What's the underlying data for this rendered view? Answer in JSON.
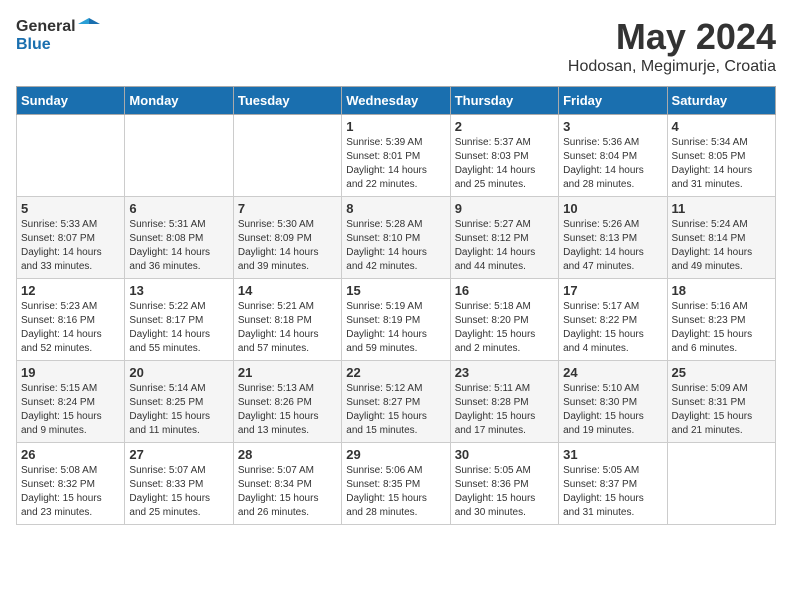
{
  "header": {
    "logo_general": "General",
    "logo_blue": "Blue",
    "month_title": "May 2024",
    "location": "Hodosan, Megimurje, Croatia"
  },
  "weekdays": [
    "Sunday",
    "Monday",
    "Tuesday",
    "Wednesday",
    "Thursday",
    "Friday",
    "Saturday"
  ],
  "weeks": [
    [
      {
        "day": "",
        "content": ""
      },
      {
        "day": "",
        "content": ""
      },
      {
        "day": "",
        "content": ""
      },
      {
        "day": "1",
        "content": "Sunrise: 5:39 AM\nSunset: 8:01 PM\nDaylight: 14 hours\nand 22 minutes."
      },
      {
        "day": "2",
        "content": "Sunrise: 5:37 AM\nSunset: 8:03 PM\nDaylight: 14 hours\nand 25 minutes."
      },
      {
        "day": "3",
        "content": "Sunrise: 5:36 AM\nSunset: 8:04 PM\nDaylight: 14 hours\nand 28 minutes."
      },
      {
        "day": "4",
        "content": "Sunrise: 5:34 AM\nSunset: 8:05 PM\nDaylight: 14 hours\nand 31 minutes."
      }
    ],
    [
      {
        "day": "5",
        "content": "Sunrise: 5:33 AM\nSunset: 8:07 PM\nDaylight: 14 hours\nand 33 minutes."
      },
      {
        "day": "6",
        "content": "Sunrise: 5:31 AM\nSunset: 8:08 PM\nDaylight: 14 hours\nand 36 minutes."
      },
      {
        "day": "7",
        "content": "Sunrise: 5:30 AM\nSunset: 8:09 PM\nDaylight: 14 hours\nand 39 minutes."
      },
      {
        "day": "8",
        "content": "Sunrise: 5:28 AM\nSunset: 8:10 PM\nDaylight: 14 hours\nand 42 minutes."
      },
      {
        "day": "9",
        "content": "Sunrise: 5:27 AM\nSunset: 8:12 PM\nDaylight: 14 hours\nand 44 minutes."
      },
      {
        "day": "10",
        "content": "Sunrise: 5:26 AM\nSunset: 8:13 PM\nDaylight: 14 hours\nand 47 minutes."
      },
      {
        "day": "11",
        "content": "Sunrise: 5:24 AM\nSunset: 8:14 PM\nDaylight: 14 hours\nand 49 minutes."
      }
    ],
    [
      {
        "day": "12",
        "content": "Sunrise: 5:23 AM\nSunset: 8:16 PM\nDaylight: 14 hours\nand 52 minutes."
      },
      {
        "day": "13",
        "content": "Sunrise: 5:22 AM\nSunset: 8:17 PM\nDaylight: 14 hours\nand 55 minutes."
      },
      {
        "day": "14",
        "content": "Sunrise: 5:21 AM\nSunset: 8:18 PM\nDaylight: 14 hours\nand 57 minutes."
      },
      {
        "day": "15",
        "content": "Sunrise: 5:19 AM\nSunset: 8:19 PM\nDaylight: 14 hours\nand 59 minutes."
      },
      {
        "day": "16",
        "content": "Sunrise: 5:18 AM\nSunset: 8:20 PM\nDaylight: 15 hours\nand 2 minutes."
      },
      {
        "day": "17",
        "content": "Sunrise: 5:17 AM\nSunset: 8:22 PM\nDaylight: 15 hours\nand 4 minutes."
      },
      {
        "day": "18",
        "content": "Sunrise: 5:16 AM\nSunset: 8:23 PM\nDaylight: 15 hours\nand 6 minutes."
      }
    ],
    [
      {
        "day": "19",
        "content": "Sunrise: 5:15 AM\nSunset: 8:24 PM\nDaylight: 15 hours\nand 9 minutes."
      },
      {
        "day": "20",
        "content": "Sunrise: 5:14 AM\nSunset: 8:25 PM\nDaylight: 15 hours\nand 11 minutes."
      },
      {
        "day": "21",
        "content": "Sunrise: 5:13 AM\nSunset: 8:26 PM\nDaylight: 15 hours\nand 13 minutes."
      },
      {
        "day": "22",
        "content": "Sunrise: 5:12 AM\nSunset: 8:27 PM\nDaylight: 15 hours\nand 15 minutes."
      },
      {
        "day": "23",
        "content": "Sunrise: 5:11 AM\nSunset: 8:28 PM\nDaylight: 15 hours\nand 17 minutes."
      },
      {
        "day": "24",
        "content": "Sunrise: 5:10 AM\nSunset: 8:30 PM\nDaylight: 15 hours\nand 19 minutes."
      },
      {
        "day": "25",
        "content": "Sunrise: 5:09 AM\nSunset: 8:31 PM\nDaylight: 15 hours\nand 21 minutes."
      }
    ],
    [
      {
        "day": "26",
        "content": "Sunrise: 5:08 AM\nSunset: 8:32 PM\nDaylight: 15 hours\nand 23 minutes."
      },
      {
        "day": "27",
        "content": "Sunrise: 5:07 AM\nSunset: 8:33 PM\nDaylight: 15 hours\nand 25 minutes."
      },
      {
        "day": "28",
        "content": "Sunrise: 5:07 AM\nSunset: 8:34 PM\nDaylight: 15 hours\nand 26 minutes."
      },
      {
        "day": "29",
        "content": "Sunrise: 5:06 AM\nSunset: 8:35 PM\nDaylight: 15 hours\nand 28 minutes."
      },
      {
        "day": "30",
        "content": "Sunrise: 5:05 AM\nSunset: 8:36 PM\nDaylight: 15 hours\nand 30 minutes."
      },
      {
        "day": "31",
        "content": "Sunrise: 5:05 AM\nSunset: 8:37 PM\nDaylight: 15 hours\nand 31 minutes."
      },
      {
        "day": "",
        "content": ""
      }
    ]
  ]
}
